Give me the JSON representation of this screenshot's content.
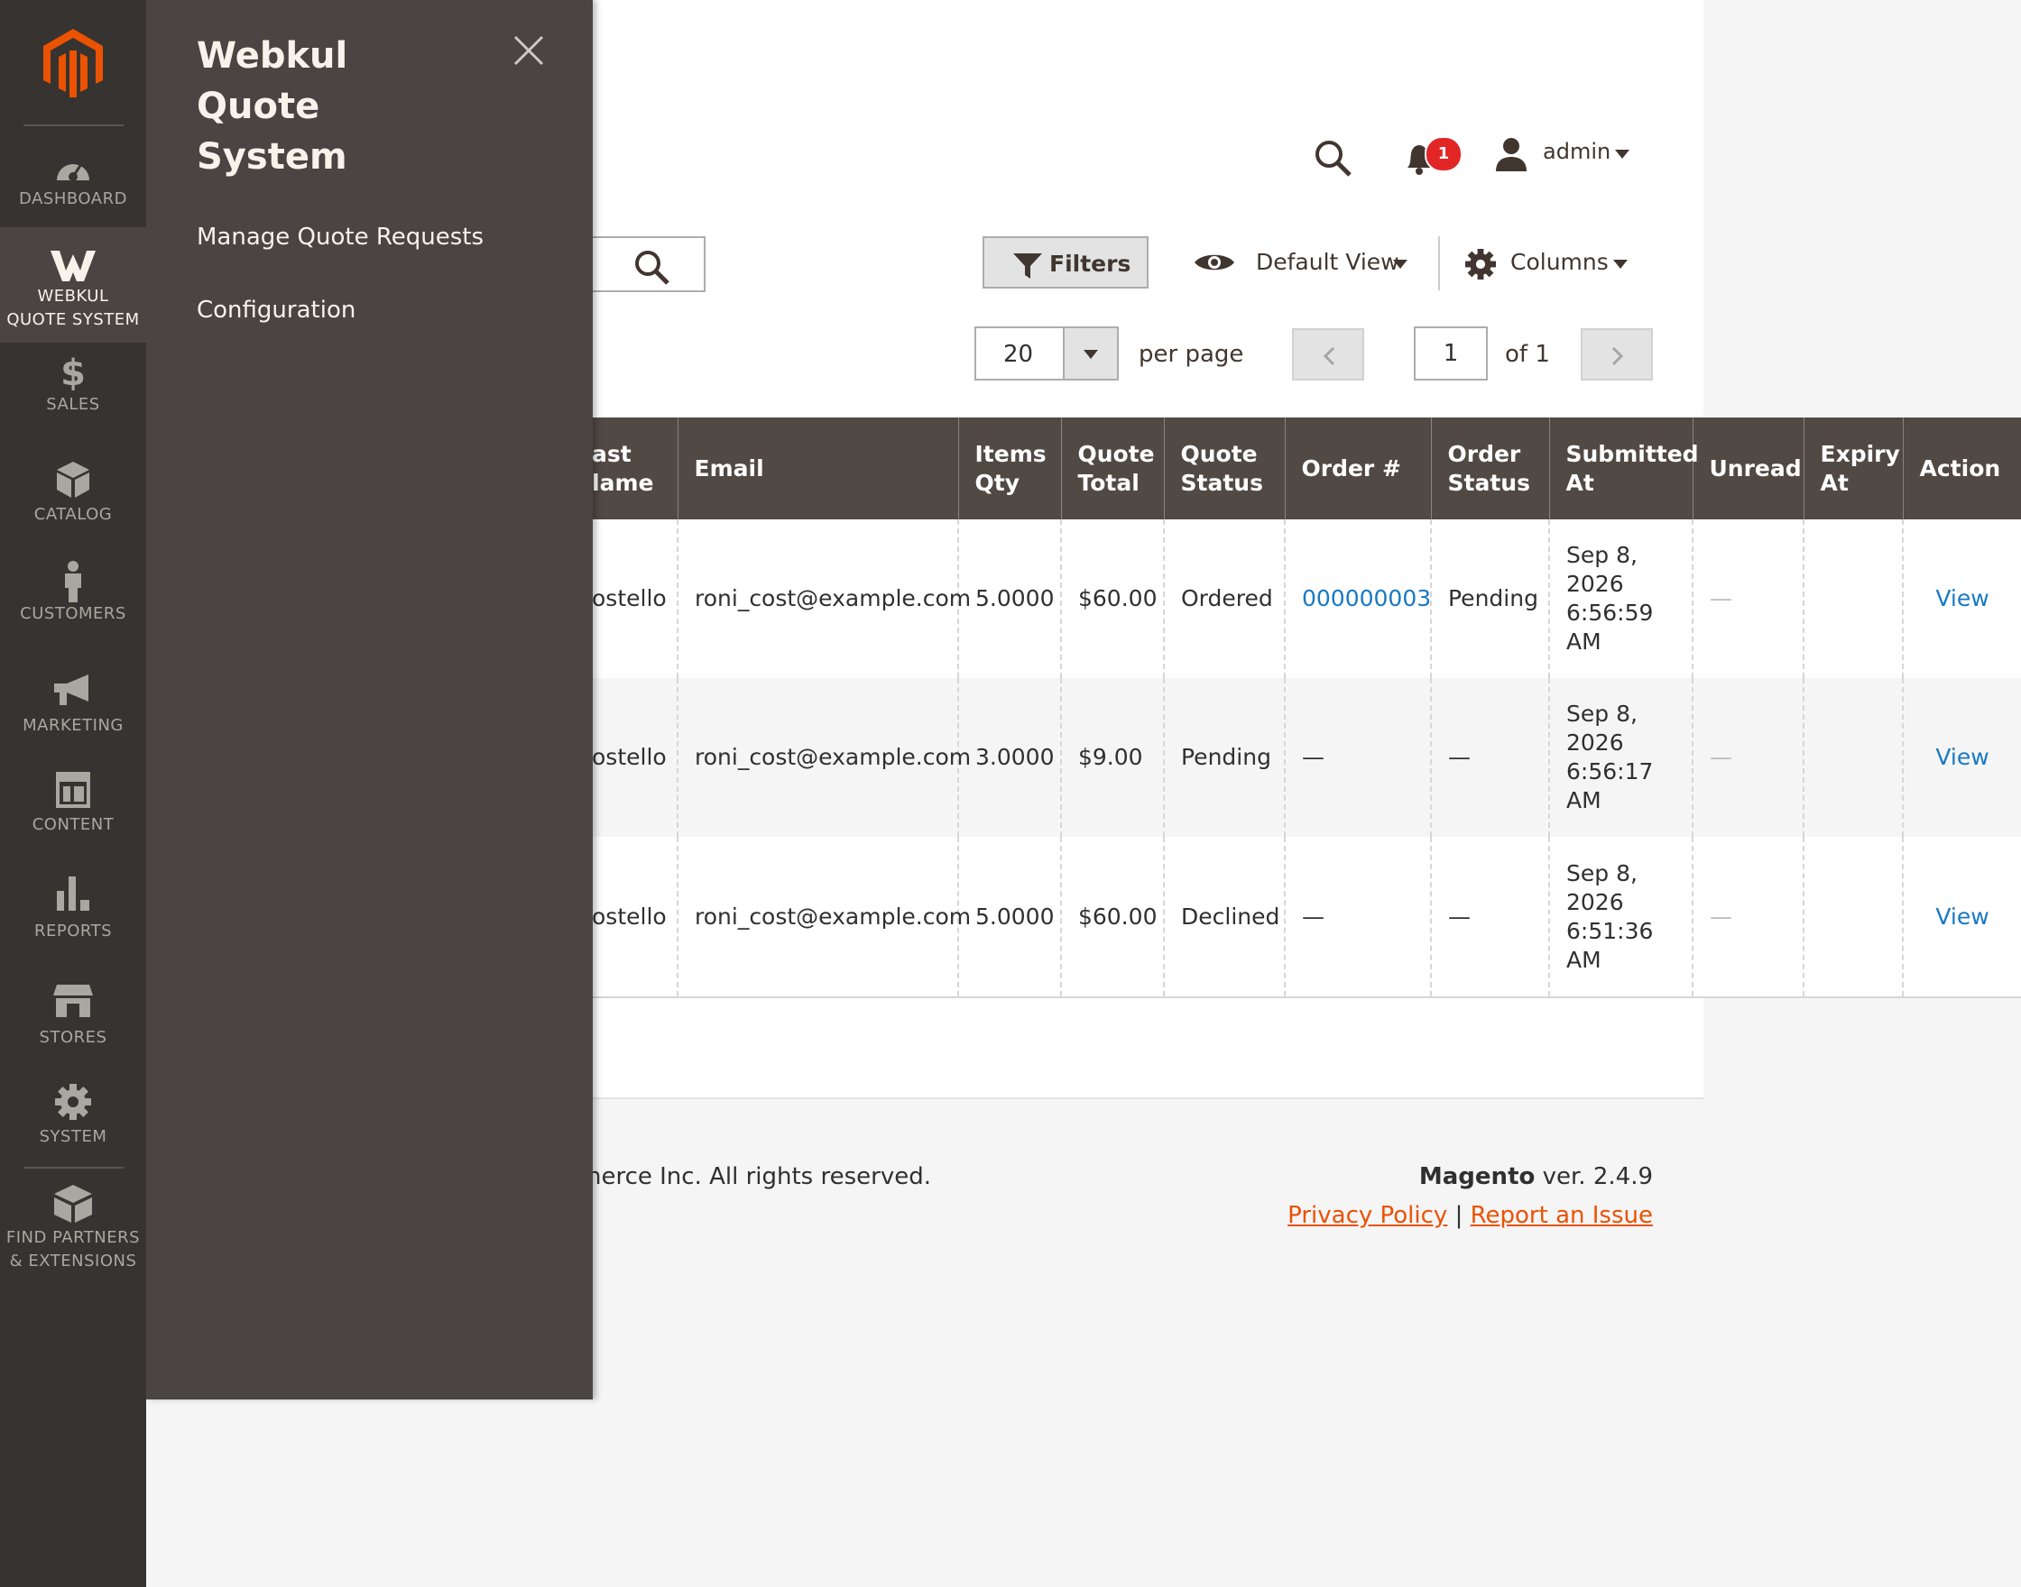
{
  "nav": {
    "items": [
      {
        "label": "DASHBOARD",
        "icon": "dashboard-icon"
      },
      {
        "label": "WEBKUL QUOTE SYSTEM",
        "line1": "WEBKUL",
        "line2": "QUOTE SYSTEM",
        "icon": "webkul-icon",
        "active": true
      },
      {
        "label": "SALES",
        "icon": "dollar-icon"
      },
      {
        "label": "CATALOG",
        "icon": "box-icon"
      },
      {
        "label": "CUSTOMERS",
        "icon": "person-icon"
      },
      {
        "label": "MARKETING",
        "icon": "megaphone-icon"
      },
      {
        "label": "CONTENT",
        "icon": "layout-icon"
      },
      {
        "label": "REPORTS",
        "icon": "bar-chart-icon"
      },
      {
        "label": "STORES",
        "icon": "storefront-icon"
      },
      {
        "label": "SYSTEM",
        "icon": "gear-icon"
      },
      {
        "label": "FIND PARTNERS & EXTENSIONS",
        "line1": "FIND PARTNERS",
        "line2": "& EXTENSIONS",
        "icon": "extensions-icon"
      }
    ]
  },
  "flyout": {
    "title_line1": "Webkul Quote",
    "title_line2": "System",
    "links": [
      "Manage Quote Requests",
      "Configuration"
    ]
  },
  "header": {
    "notification_count": "1",
    "user": "admin"
  },
  "toolbar": {
    "filters_label": "Filters",
    "view_label": "Default View",
    "columns_label": "Columns"
  },
  "pager": {
    "per_page": "20",
    "per_page_label": "per page",
    "current_page": "1",
    "of_label": "of 1"
  },
  "grid": {
    "columns": [
      {
        "line1": "ast",
        "line2": "lame"
      },
      {
        "line1": "Email",
        "line2": ""
      },
      {
        "line1": "Items",
        "line2": "Qty"
      },
      {
        "line1": "Quote",
        "line2": "Total"
      },
      {
        "line1": "Quote",
        "line2": "Status"
      },
      {
        "line1": "Order #",
        "line2": ""
      },
      {
        "line1": "Order",
        "line2": "Status"
      },
      {
        "line1": "Submitted",
        "line2": "At"
      },
      {
        "line1": "Unread",
        "line2": ""
      },
      {
        "line1": "Expiry",
        "line2": "At"
      },
      {
        "line1": "Action",
        "line2": ""
      }
    ],
    "rows": [
      {
        "last_name": "ostello",
        "email": "roni_cost@example.com",
        "qty": "5.0000",
        "total": "$60.00",
        "status": "Ordered",
        "order_num": "000000003",
        "order_status": "Pending",
        "submitted": [
          "Sep 8,",
          "2026",
          "6:56:59",
          "AM"
        ],
        "unread": "—",
        "expiry": "",
        "action": "View"
      },
      {
        "last_name": "ostello",
        "email": "roni_cost@example.com",
        "qty": "3.0000",
        "total": "$9.00",
        "status": "Pending",
        "order_num": "—",
        "order_status": "—",
        "submitted": [
          "Sep 8,",
          "2026",
          "6:56:17",
          "AM"
        ],
        "unread": "—",
        "expiry": "",
        "action": "View"
      },
      {
        "last_name": "ostello",
        "email": "roni_cost@example.com",
        "qty": "5.0000",
        "total": "$60.00",
        "status": "Declined",
        "order_num": "—",
        "order_status": "—",
        "submitted": [
          "Sep 8,",
          "2026",
          "6:51:36",
          "AM"
        ],
        "unread": "—",
        "expiry": "",
        "action": "View"
      }
    ]
  },
  "footer": {
    "copyright": "merce Inc. All rights reserved.",
    "brand": "Magento",
    "version": " ver. 2.4.9",
    "privacy": "Privacy Policy",
    "separator": "|",
    "report": "Report an Issue"
  },
  "colors": {
    "nav_bg": "#373330",
    "flyout_bg": "#4a4542",
    "table_header": "#514943",
    "link_blue": "#1979c3",
    "footer_link": "#eb5202",
    "logo_orange": "#eb5202",
    "badge_red": "#e22626"
  }
}
